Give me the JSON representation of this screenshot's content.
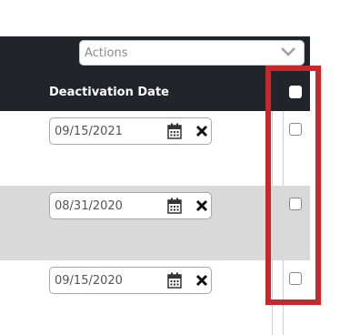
{
  "toolbar": {
    "actions_placeholder": "Actions"
  },
  "table": {
    "column_header": "Deactivation Date",
    "rows": [
      {
        "date": "09/15/2021",
        "checked": false
      },
      {
        "date": "08/31/2020",
        "checked": false
      },
      {
        "date": "09/15/2020",
        "checked": false
      }
    ]
  },
  "icons": {
    "dropdown": "chevron-down-icon",
    "calendar": "calendar-icon",
    "clear": "close-icon"
  },
  "colors": {
    "header_background": "#212529",
    "alt_row": "#d9d9d9",
    "highlight_box": "#c7282e"
  }
}
